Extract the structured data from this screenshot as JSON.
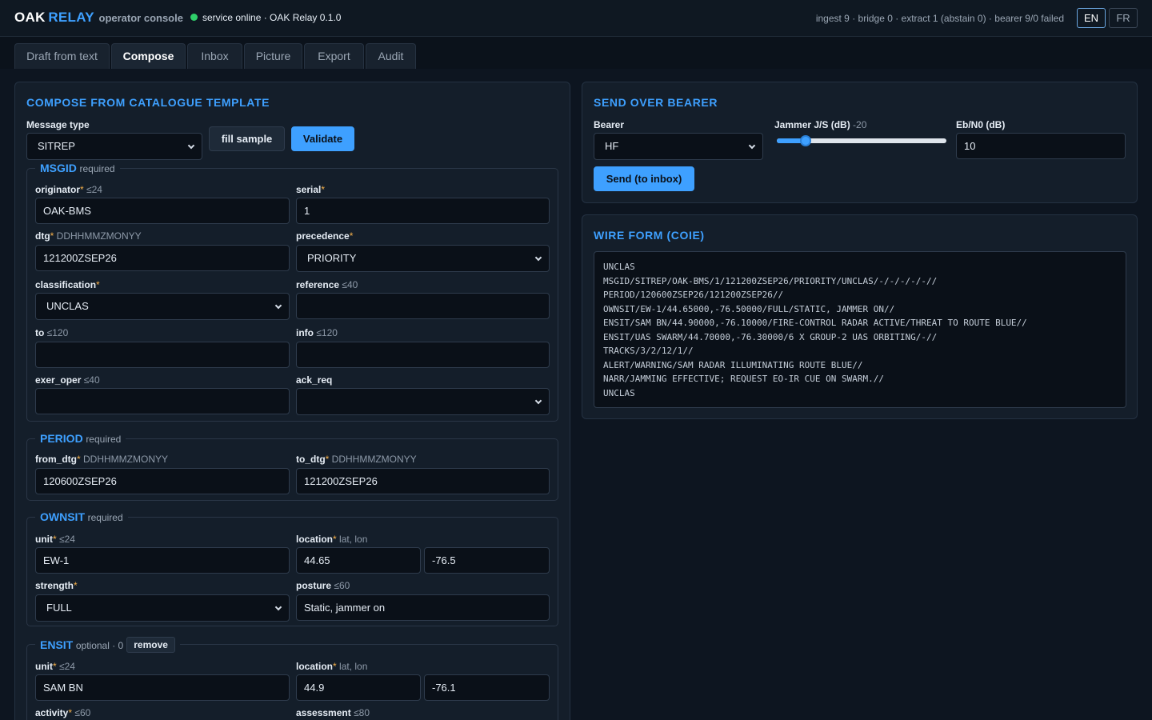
{
  "header": {
    "brand_oak": "OAK",
    "brand_relay": "RELAY",
    "brand_sub": "operator console",
    "status_text": "service online · OAK Relay 0.1.0",
    "counters": "ingest 9 · bridge 0 · extract 1 (abstain 0) · bearer 9/0 failed",
    "lang_en": "EN",
    "lang_fr": "FR",
    "status_color": "#2fcf6a",
    "accent_color": "#3ea0ff"
  },
  "tabs": [
    {
      "label": "Draft from text"
    },
    {
      "label": "Compose",
      "active": true
    },
    {
      "label": "Inbox"
    },
    {
      "label": "Picture"
    },
    {
      "label": "Export"
    },
    {
      "label": "Audit"
    }
  ],
  "compose": {
    "title": "COMPOSE FROM CATALOGUE TEMPLATE",
    "message_type_label": "Message type",
    "message_type_value": "SITREP",
    "fill_sample_label": "fill sample",
    "validate_label": "Validate",
    "required_mark": "*",
    "msgid": {
      "name": "MSGID",
      "tag": "required",
      "originator": {
        "label": "originator",
        "hint": "≤24",
        "value": "OAK-BMS"
      },
      "serial": {
        "label": "serial",
        "value": "1"
      },
      "dtg": {
        "label": "dtg",
        "hint": "DDHHMMZMONYY",
        "value": "121200ZSEP26"
      },
      "precedence": {
        "label": "precedence",
        "value": "PRIORITY"
      },
      "classification": {
        "label": "classification",
        "value": "UNCLAS"
      },
      "reference": {
        "label": "reference",
        "hint": "≤40",
        "value": ""
      },
      "to": {
        "label": "to",
        "hint": "≤120",
        "value": ""
      },
      "info": {
        "label": "info",
        "hint": "≤120",
        "value": ""
      },
      "exer_oper": {
        "label": "exer_oper",
        "hint": "≤40",
        "value": ""
      },
      "ack_req": {
        "label": "ack_req",
        "value": ""
      }
    },
    "period": {
      "name": "PERIOD",
      "tag": "required",
      "from_dtg": {
        "label": "from_dtg",
        "hint": "DDHHMMZMONYY",
        "value": "120600ZSEP26"
      },
      "to_dtg": {
        "label": "to_dtg",
        "hint": "DDHHMMZMONYY",
        "value": "121200ZSEP26"
      }
    },
    "ownsit": {
      "name": "OWNSIT",
      "tag": "required",
      "unit": {
        "label": "unit",
        "hint": "≤24",
        "value": "EW-1"
      },
      "location": {
        "label": "location",
        "hint": "lat, lon",
        "lat": "44.65",
        "lon": "-76.5"
      },
      "strength": {
        "label": "strength",
        "value": "FULL"
      },
      "posture": {
        "label": "posture",
        "hint": "≤60",
        "value": "Static, jammer on"
      }
    },
    "ensit": {
      "name": "ENSIT",
      "tag": "optional · 0",
      "remove_label": "remove",
      "unit": {
        "label": "unit",
        "hint": "≤24",
        "value": "SAM BN"
      },
      "location": {
        "label": "location",
        "hint": "lat, lon",
        "lat": "44.9",
        "lon": "-76.1"
      },
      "activity": {
        "label": "activity",
        "hint": "≤60"
      },
      "assessment": {
        "label": "assessment",
        "hint": "≤80"
      }
    }
  },
  "bearer": {
    "title": "SEND OVER BEARER",
    "bearer_label": "Bearer",
    "bearer_value": "HF",
    "jammer_label": "Jammer J/S (dB)",
    "jammer_value": "-20",
    "jammer_fraction": 0.17,
    "ebno_label": "Eb/N0 (dB)",
    "ebno_value": "10",
    "send_label": "Send (to inbox)"
  },
  "wire": {
    "title": "WIRE FORM (COIE)",
    "lines": [
      "UNCLAS",
      "MSGID/SITREP/OAK-BMS/1/121200ZSEP26/PRIORITY/UNCLAS/-/-/-/-/-//",
      "PERIOD/120600ZSEP26/121200ZSEP26//",
      "OWNSIT/EW-1/44.65000,-76.50000/FULL/STATIC, JAMMER ON//",
      "ENSIT/SAM BN/44.90000,-76.10000/FIRE-CONTROL RADAR ACTIVE/THREAT TO ROUTE BLUE//",
      "ENSIT/UAS SWARM/44.70000,-76.30000/6 X GROUP-2 UAS ORBITING/-//",
      "TRACKS/3/2/12/1//",
      "ALERT/WARNING/SAM RADAR ILLUMINATING ROUTE BLUE//",
      "NARR/JAMMING EFFECTIVE; REQUEST EO-IR CUE ON SWARM.//",
      "UNCLAS"
    ]
  }
}
